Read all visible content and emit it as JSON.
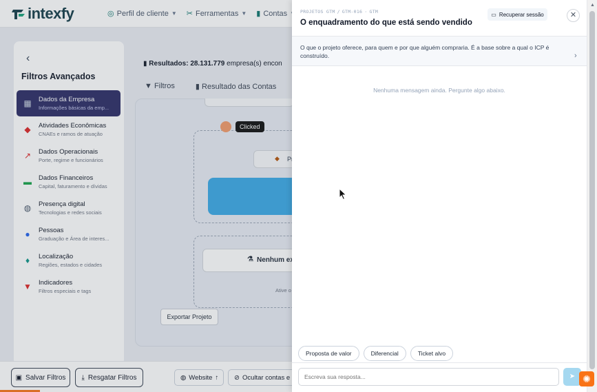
{
  "app": {
    "logo_text": "intexfy",
    "nav": [
      {
        "label": "Perfil de cliente",
        "icon": "target-icon"
      },
      {
        "label": "Ferramentas",
        "icon": "tools-icon"
      },
      {
        "label": "Contas",
        "icon": "building-icon"
      }
    ]
  },
  "sidebar": {
    "title": "Filtros Avançados",
    "items": [
      {
        "label": "Dados da Empresa",
        "sub": "Informações básicas da emp...",
        "icon": "building-icon",
        "icon_color": "#cbd5e1",
        "active": true
      },
      {
        "label": "Atividades Econômicas",
        "sub": "CNAEs e ramos de atuação",
        "icon": "tag-icon",
        "icon_color": "#dc2626"
      },
      {
        "label": "Dados Operacionais",
        "sub": "Porte, regime e funcionários",
        "icon": "chart-line-icon",
        "icon_color": "#dc2626"
      },
      {
        "label": "Dados Financeiros",
        "sub": "Capital, faturamento e dívidas",
        "icon": "money-icon",
        "icon_color": "#16a34a"
      },
      {
        "label": "Presença digital",
        "sub": "Tecnologias e redes sociais",
        "icon": "globe-icon",
        "icon_color": "#475569"
      },
      {
        "label": "Pessoas",
        "sub": "Graduação e Área de interes...",
        "icon": "users-icon",
        "icon_color": "#2563eb"
      },
      {
        "label": "Localização",
        "sub": "Regiões, estados e cidades",
        "icon": "map-pin-icon",
        "icon_color": "#0d9488"
      },
      {
        "label": "Indicadores",
        "sub": "Filtros especiais e tags",
        "icon": "filter-icon",
        "icon_color": "#dc2626"
      }
    ]
  },
  "main": {
    "results_label": "Resultados:",
    "results_value": "28.131.779",
    "results_suffix": "empresa(s) encon",
    "tabs": [
      "Filtros",
      "Resultado das Contas"
    ],
    "node_partial": "Pr",
    "node_empty": "Nenhum ex",
    "node_hint": "Ative o",
    "export_label": "Exportar Projeto"
  },
  "clicked_tooltip": "Clicked",
  "bottom": {
    "save": "Salvar Filtros",
    "restore": "Resgatar Filtros",
    "website": "Website",
    "hide": "Ocultar contas e"
  },
  "panel": {
    "crumb": [
      "PROJETOS GTM",
      "GTM-016",
      "GTM"
    ],
    "title": "O enquadramento do que está sendo vendido",
    "recover": "Recuperar sessão",
    "context": "O que o projeto oferece, para quem e por que alguém compraria. É a base sobre a qual o ICP é construído.",
    "empty": "Nenhuma mensagem ainda. Pergunte algo abaixo.",
    "chips": [
      "Proposta de valor",
      "Diferencial",
      "Ticket alvo"
    ],
    "placeholder": "Escreva sua resposta..."
  }
}
